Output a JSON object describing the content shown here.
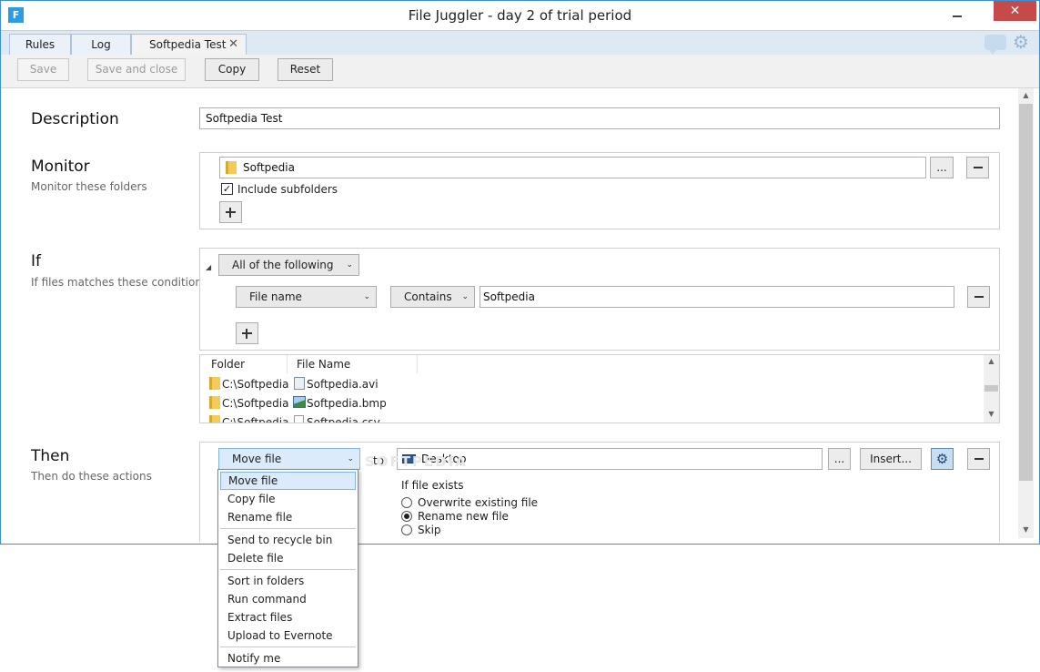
{
  "window": {
    "app_icon": "F",
    "title": "File Juggler - day 2 of trial period",
    "close_glyph": "✕",
    "tabs": [
      {
        "label": "Rules"
      },
      {
        "label": "Log"
      },
      {
        "label": "Softpedia Test",
        "close_glyph": "✕"
      }
    ],
    "icons": [
      "chat-icon",
      "settings-gear-icon"
    ]
  },
  "toolbar": {
    "save": "Save",
    "save_and_close": "Save and close",
    "copy": "Copy",
    "reset": "Reset"
  },
  "description": {
    "title": "Description",
    "value": "Softpedia Test"
  },
  "monitor": {
    "title": "Monitor",
    "subtitle": "Monitor these folders",
    "folder": "Softpedia",
    "browse": "...",
    "include_subfolders": "Include subfolders",
    "include_subfolders_checked": true,
    "check_glyph": "✓"
  },
  "if": {
    "title": "If",
    "subtitle": "If files matches these conditions",
    "group_mode": "All of the following",
    "condition": {
      "field": "File name",
      "operator": "Contains",
      "value": "Softpedia"
    },
    "list": {
      "columns": [
        "Folder",
        "File Name"
      ],
      "rows": [
        {
          "folder": "C:\\Softpedia",
          "file": "Softpedia.avi",
          "icon": "video-file-icon"
        },
        {
          "folder": "C:\\Softpedia",
          "file": "Softpedia.bmp",
          "icon": "image-file-icon"
        },
        {
          "folder": "C:\\Softpedia",
          "file": "Softpedia.csv",
          "icon": "document-file-icon"
        }
      ]
    }
  },
  "then": {
    "title": "Then",
    "subtitle": "Then do these actions",
    "action": "Move file",
    "to_label": "to",
    "destination": "Desktop",
    "browse": "...",
    "insert": "Insert...",
    "if_exists_label": "If file exists",
    "options": [
      {
        "label": "Overwrite existing file",
        "selected": false
      },
      {
        "label": "Rename new file",
        "selected": true
      },
      {
        "label": "Skip",
        "selected": false
      }
    ]
  },
  "dropdown": {
    "groups": [
      [
        "Move file",
        "Copy file",
        "Rename file"
      ],
      [
        "Send to recycle bin",
        "Delete file"
      ],
      [
        "Sort in folders",
        "Run command",
        "Extract files",
        "Upload to Evernote"
      ],
      [
        "Notify me"
      ]
    ],
    "selected": "Move file"
  },
  "watermark": "SOFTPEDIA",
  "colors": {
    "accent": "#3c8fd8",
    "close_button": "#c74a4a",
    "tabstrip": "#dde9f5",
    "selection": "#dcebfb"
  }
}
